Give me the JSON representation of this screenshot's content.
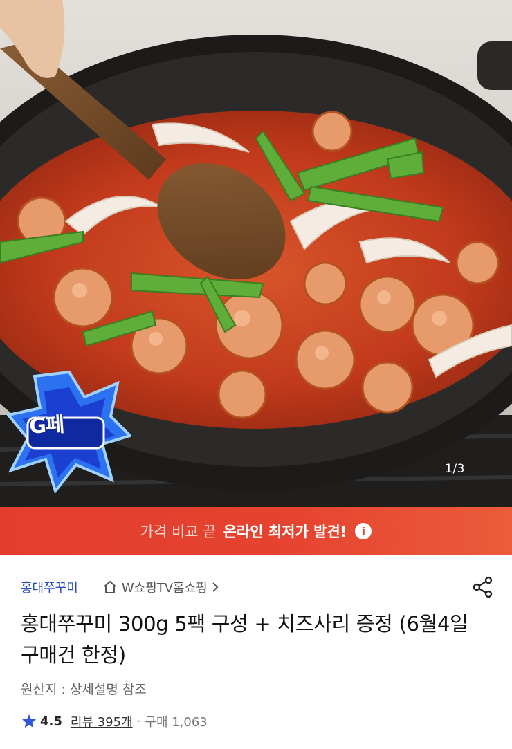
{
  "hero": {
    "image_counter": "1/3",
    "badge_text": "G페"
  },
  "promo": {
    "text_plain": "가격 비교 끝",
    "text_strong": "온라인 최저가 발견!",
    "info_icon": "info-icon"
  },
  "product": {
    "brand": "홍대쭈꾸미",
    "shop_name": "W쇼핑TV홈쇼핑",
    "shop_icon": "home-icon",
    "share_icon": "share-icon",
    "title": "홍대쭈꾸미 300g 5팩 구성 + 치즈사리 증정 (6월4일 구매건 한정)",
    "origin": "원산지 : 상세설명 참조",
    "rating": "4.5",
    "review_label": "리뷰 395개",
    "purchase_label": "구매 1,063"
  },
  "colors": {
    "brand_blue": "#2a4fb8",
    "promo_red": "#e5432f",
    "star_blue": "#2f57d6"
  }
}
